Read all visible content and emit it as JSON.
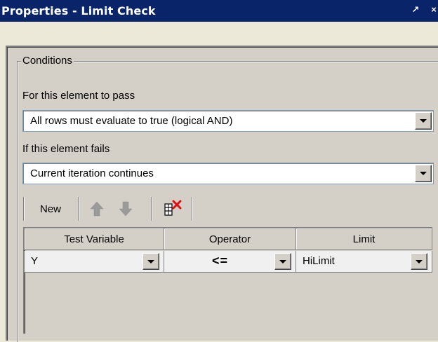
{
  "window": {
    "title": "Properties - Limit Check",
    "pin_glyph": "↗",
    "close_glyph": "×"
  },
  "conditions": {
    "group_label": "Conditions",
    "pass_label": "For this element to pass",
    "pass_value": "All rows must evaluate to true (logical AND)",
    "fail_label": "If this element fails",
    "fail_value": "Current iteration continues"
  },
  "toolbar": {
    "new_label": "New",
    "move_up_icon": "arrow-up-icon",
    "move_down_icon": "arrow-down-icon",
    "delete_icon": "delete-row-icon",
    "delete_color": "#e01010"
  },
  "table": {
    "columns": [
      "Test Variable",
      "Operator",
      "Limit"
    ],
    "rows": [
      {
        "test_variable": "Y",
        "operator": "<=",
        "limit": "HiLimit"
      }
    ]
  },
  "colors": {
    "titlebar": "#0a246a",
    "face": "#d4d0c8"
  }
}
